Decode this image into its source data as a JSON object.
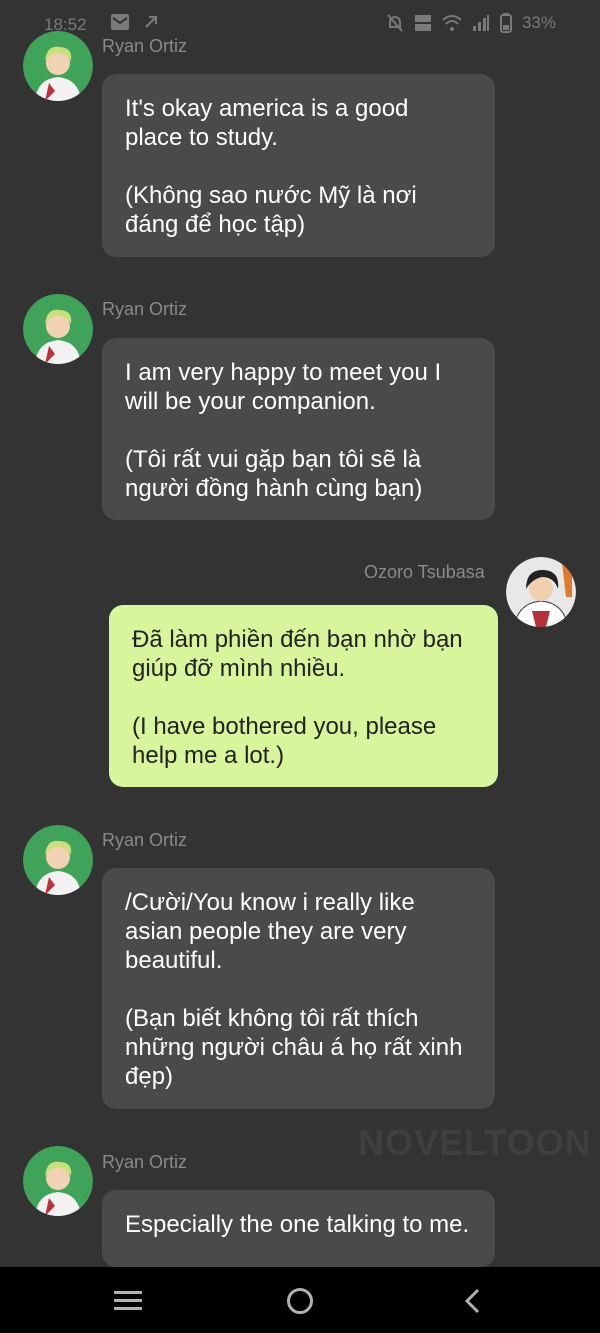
{
  "status_bar": {
    "time": "18:52",
    "battery": "33%",
    "icons": [
      "mail-icon",
      "notification-icon",
      "mute-icon",
      "volte-icon",
      "wifi-icon",
      "signal-icon",
      "battery-icon"
    ]
  },
  "messages": [
    {
      "sender": "Ryan Ortiz",
      "side": "left",
      "text": "It's okay america is a good place to study.\n\n(Không sao nước Mỹ là nơi đáng để học tập)"
    },
    {
      "sender": "Ryan Ortiz",
      "side": "left",
      "text": "I am very happy to meet you I will be your companion.\n\n(Tôi rất vui gặp bạn tôi sẽ là người đồng hành cùng bạn)"
    },
    {
      "sender": "Ozoro Tsubasa",
      "side": "right",
      "text": "Đã làm phiền đến bạn nhờ bạn giúp đỡ mình nhiều.\n\n(I have bothered you, please help me a lot.)"
    },
    {
      "sender": "Ryan Ortiz",
      "side": "left",
      "text": "/Cười/You know i really like asian people they are very beautiful.\n\n(Bạn biết không tôi rất thích những người châu á họ rất xinh đẹp)"
    },
    {
      "sender": "Ryan Ortiz",
      "side": "left",
      "text": "Especially the one talking to me."
    }
  ],
  "watermark": "NOVELTOON",
  "nav_bar": {
    "icons": [
      "menu-icon",
      "home-icon",
      "back-icon"
    ]
  },
  "colors": {
    "background": "#333333",
    "received_bubble": "#4a4a4a",
    "sent_bubble": "#d8f59c",
    "name_text": "#8a8a8a"
  }
}
